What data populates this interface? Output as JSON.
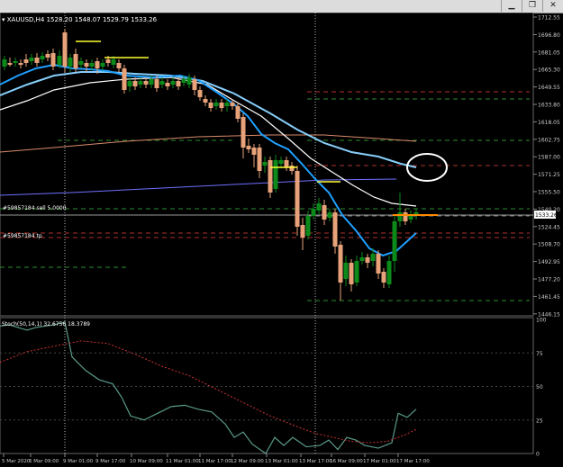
{
  "window": {
    "min_symbol": "▁",
    "restore_symbol": "❐",
    "close_symbol": "✕"
  },
  "header": {
    "symbol": "XAUUSD,H4",
    "ohlc": "1528.20 1548.07 1529.79 1533.26"
  },
  "price_axis": {
    "labels": [
      "1712.55",
      "1696.80",
      "1681.05",
      "1665.30",
      "1649.55",
      "1633.80",
      "1618.05",
      "1602.75",
      "1587.00",
      "1571.25",
      "1555.50",
      "1540.20",
      "1524.45",
      "1508.70",
      "1492.95",
      "1477.20",
      "1461.45",
      "1446.15"
    ],
    "current_price": "1533.26",
    "current_price_color": "#ffffff"
  },
  "orders": {
    "sell_label": "#59857184 sell 5.0000",
    "tp_label": "#59857184 tp"
  },
  "osc": {
    "label": "Stoch(50,14,1) 32.6756 18.3789",
    "scale": [
      "100",
      "75",
      "50",
      "25",
      "0"
    ]
  },
  "time_axis": {
    "labels": [
      "5 Mar 2020",
      "6 Mar 09:00",
      "9 Mar 01:00",
      "9 Mar 17:00",
      "10 Mar 09:00",
      "11 Mar 01:00",
      "11 Mar 17:00",
      "12 Mar 09:00",
      "13 Mar 01:00",
      "13 Mar 17:00",
      "16 Mar 09:00",
      "17 Mar 01:00",
      "17 Mar 17:00"
    ]
  },
  "colors": {
    "bull": "#0b8a1a",
    "bear": "#e8a27a",
    "ma_fast": "#1fa0ff",
    "ma_mid": "#87cefa",
    "ma_white": "#ffffff",
    "ma_slow": "#d98a6a",
    "ma_blue": "#6f6fff",
    "stoch_main": "#5a9a8a",
    "stoch_signal": "#cc3333",
    "dash_green": "#2e8b2e",
    "dash_red": "#b03030",
    "yellow": "#ffff33"
  }
}
